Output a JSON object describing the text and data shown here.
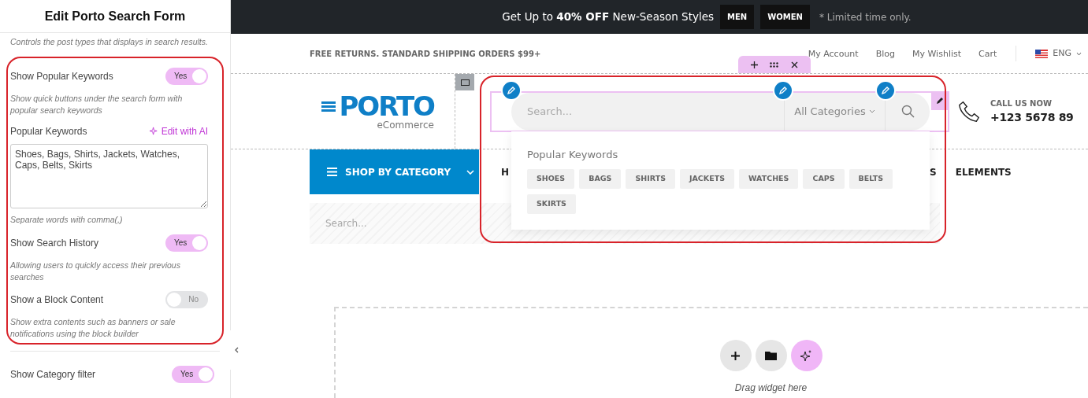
{
  "panel": {
    "title": "Edit Porto Search Form",
    "intro": "Controls the post types that displays in search results.",
    "highlighted_settings": [
      {
        "kind": "toggle",
        "label": "Show Popular Keywords",
        "on": true,
        "state_label": "Yes",
        "hint": "Show quick buttons under the search form with popular search keywords"
      },
      {
        "kind": "textarea",
        "label": "Popular Keywords",
        "action": "Edit with AI",
        "value": "Shoes, Bags, Shirts, Jackets, Watches, Caps, Belts, Skirts",
        "hint": "Separate words with comma(,)"
      },
      {
        "kind": "toggle",
        "label": "Show Search History",
        "on": true,
        "state_label": "Yes",
        "hint": "Allowing users to quickly access their previous searches"
      },
      {
        "kind": "toggle",
        "label": "Show a Block Content",
        "on": false,
        "state_label": "No",
        "hint": "Show extra contents such as banners or sale notifications using the block builder"
      }
    ],
    "settings": [
      {
        "kind": "toggle",
        "label": "Show Category filter",
        "on": true,
        "state_label": "Yes"
      }
    ]
  },
  "announcement": {
    "text": "Get Up to **40% OFF** New-Season Styles",
    "buttons": [
      "MEN",
      "WOMEN"
    ],
    "note": "* Limited time only."
  },
  "top_bar": {
    "shipping": "FREE RETURNS. STANDARD SHIPPING ORDERS $99+",
    "links": [
      "My Account",
      "Blog",
      "My Wishlist",
      "Cart"
    ],
    "language": "ENG"
  },
  "logo": {
    "name": "PORTO",
    "tagline": "eCommerce"
  },
  "search_form": {
    "placeholder": "Search...",
    "category": "All Categories",
    "popular_title": "Popular Keywords",
    "keywords": [
      "SHOES",
      "BAGS",
      "SHIRTS",
      "JACKETS",
      "WATCHES",
      "CAPS",
      "BELTS",
      "SKIRTS"
    ]
  },
  "contact": {
    "label": "CALL US NOW",
    "phone": "+123 5678 89"
  },
  "nav": {
    "category_button": "SHOP BY CATEGORY",
    "items": [
      "H",
      "S",
      "ELEMENTS"
    ]
  },
  "secondary_search": {
    "placeholder": "Search..."
  },
  "drop_zone": {
    "hint": "Drag widget here"
  }
}
